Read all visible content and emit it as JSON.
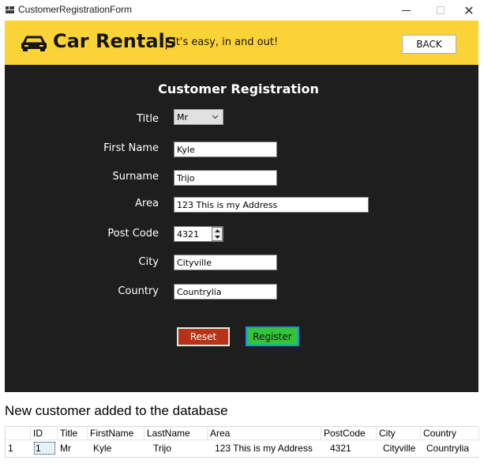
{
  "window": {
    "title": "CustomerRegistrationForm",
    "minimize_symbol": "",
    "maximize_symbol": "",
    "close_symbol": "✕"
  },
  "header": {
    "brand": "Car Rentals",
    "separator": "|",
    "tagline": "It's easy, in and out!",
    "back_label": "BACK",
    "icon": "car-icon",
    "background_color": "#fbd337"
  },
  "form": {
    "title": "Customer Registration",
    "background_color": "#1e1e1e",
    "fields": {
      "title": {
        "label": "Title",
        "value": "Mr"
      },
      "first_name": {
        "label": "First Name",
        "value": "Kyle"
      },
      "surname": {
        "label": "Surname",
        "value": "Trijo"
      },
      "area": {
        "label": "Area",
        "value": "123 This is my Address"
      },
      "post_code": {
        "label": "Post Code",
        "value": "4321"
      },
      "city": {
        "label": "City",
        "value": "Cityville"
      },
      "country": {
        "label": "Country",
        "value": "Countrylia"
      }
    },
    "reset_label": "Reset",
    "register_label": "Register",
    "reset_color": "#b83217",
    "register_color": "#35c33a"
  },
  "caption": "New customer added to the database",
  "grid": {
    "columns": [
      "ID",
      "Title",
      "FirstName",
      "LastName",
      "Area",
      "PostCode",
      "City",
      "Country"
    ],
    "rows": [
      {
        "row_number": "1",
        "cells": [
          "1",
          "Mr",
          "Kyle",
          "Trijo",
          "123 This is my Address",
          "4321",
          "Cityville",
          "Countrylia"
        ]
      }
    ]
  }
}
